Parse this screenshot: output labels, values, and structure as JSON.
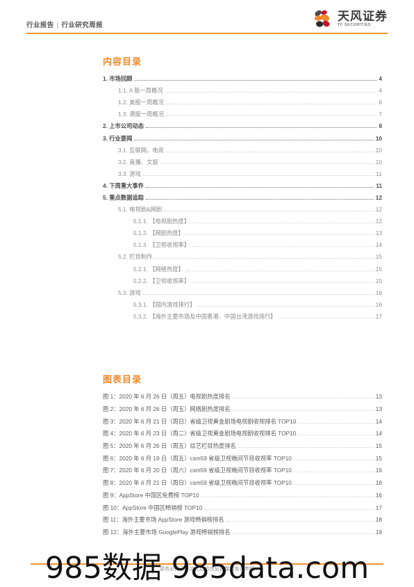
{
  "header": {
    "breadcrumb_primary": "行业报告",
    "breadcrumb_separator": "|",
    "breadcrumb_secondary": "行业研究周报",
    "logo_cn": "天风证券",
    "logo_en": "TF SECURITIES"
  },
  "colors": {
    "accent_orange": "#f0892b",
    "rule_orange": "#f0932b",
    "heading_gray": "#4a4a4c",
    "body_gray": "#8a8a8c"
  },
  "contents": {
    "title": "内容目录",
    "items": [
      {
        "level": 1,
        "label": "1. 市场回顾",
        "page": "4"
      },
      {
        "level": 2,
        "label": "1.1. A 股一周概况",
        "page": "4"
      },
      {
        "level": 2,
        "label": "1.2. 美股一周概况",
        "page": "6"
      },
      {
        "level": 2,
        "label": "1.3. 港股一周概况",
        "page": "7"
      },
      {
        "level": 1,
        "label": "2. 上市公司动态",
        "page": "8"
      },
      {
        "level": 1,
        "label": "3. 行业要闻",
        "page": "10"
      },
      {
        "level": 2,
        "label": "3.1. 互联网、电商",
        "page": "10"
      },
      {
        "level": 2,
        "label": "3.2. 直播、文娱",
        "page": "10"
      },
      {
        "level": 2,
        "label": "3.3. 游戏",
        "page": "11"
      },
      {
        "level": 1,
        "label": "4. 下周重大事件",
        "page": "11"
      },
      {
        "level": 1,
        "label": "5. 重点数据追踪",
        "page": "12"
      },
      {
        "level": 2,
        "label": "5.1. 电视剧&网剧",
        "page": "12"
      },
      {
        "level": 3,
        "label": "5.1.1. 【电视剧热度】",
        "page": "12"
      },
      {
        "level": 3,
        "label": "5.1.2. 【网剧热度】",
        "page": "13"
      },
      {
        "level": 3,
        "label": "5.1.3. 【卫视收视率】",
        "page": "14"
      },
      {
        "level": 2,
        "label": "5.2. 栏目制作",
        "page": "15"
      },
      {
        "level": 3,
        "label": "5.2.1. 【网络热度】",
        "page": "15"
      },
      {
        "level": 3,
        "label": "5.2.2. 【卫视收视率】",
        "page": "15"
      },
      {
        "level": 2,
        "label": "5.3. 游戏",
        "page": "16"
      },
      {
        "level": 3,
        "label": "5.3.1. 【国内游戏排行】",
        "page": "16"
      },
      {
        "level": 3,
        "label": "5.3.2. 【海外主要市场及中国香港、中国台湾游戏排行】",
        "page": "17"
      }
    ]
  },
  "figures": {
    "title": "图表目录",
    "items": [
      {
        "label": "图 1：2020 年 6 月 26 日（周五）电视剧热度排名",
        "page": "13"
      },
      {
        "label": "图 2：2020 年 6 月 26 日（周五）网络剧热度排名",
        "page": "13"
      },
      {
        "label": "图 3：2020 年 6 月 21 日（周日）省级卫视黄金剧场电视剧收视排名 TOP10",
        "page": "14"
      },
      {
        "label": "图 4：2020 年 6 月 23 日（周二）省级卫视黄金剧场电视剧收视排名 TOP10",
        "page": "14"
      },
      {
        "label": "图 5：2020 年 6 月 26 日（周五）综艺栏目热度排名",
        "page": "15"
      },
      {
        "label": "图 6：2020 年 6 月 19 日（周五）csm59 省级卫视晚间节目收视率 TOP10",
        "page": "15"
      },
      {
        "label": "图 7：2020 年 6 月 20 日（周六）csm59 省级卫视晚间节目收视率 TOP10",
        "page": "16"
      },
      {
        "label": "图 8：2020 年 6 月 21 日（周日）csm59 省级卫视晚间节目收视率 TOP10",
        "page": "16"
      },
      {
        "label": "图 9：AppStore 中国区免费榜 TOP10",
        "page": "16"
      },
      {
        "label": "图 10：AppStore 中国区畅销榜 TOP10",
        "page": "17"
      },
      {
        "label": "图 11：海外主要市场 AppStore 游戏畅销榜排名",
        "page": "18"
      },
      {
        "label": "图 12：海外主要市场 GooglePlay 游戏畅销榜排名",
        "page": "19"
      }
    ]
  },
  "footer": {
    "disclaimer": "请务必阅读正文之后的信息披露和免责申明",
    "watermark": "985数据 985data.com"
  }
}
